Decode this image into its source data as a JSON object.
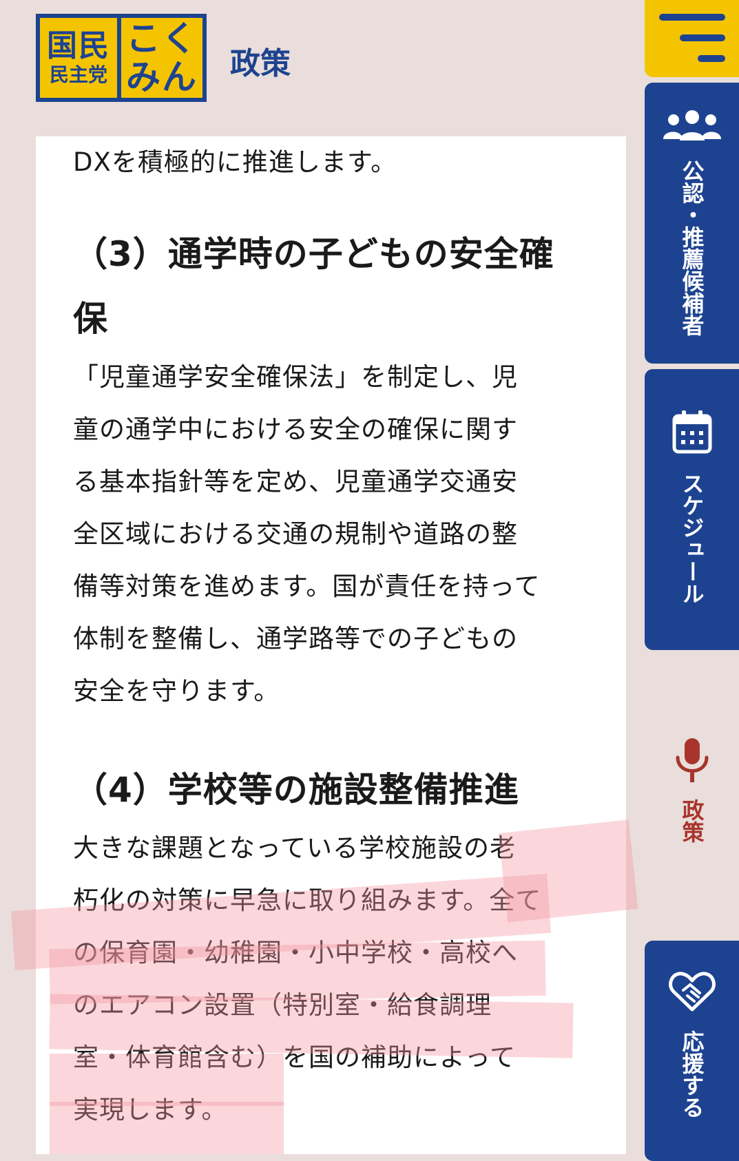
{
  "logo": {
    "line1": "国民",
    "line2": "民主党",
    "right1": "こく",
    "right2": "みん"
  },
  "page_label": "政策",
  "content": {
    "intro_tail": "DXを積極的に推進します。",
    "section3_heading_line1": "（3）通学時の子どもの安全確",
    "section3_heading_line2": "保",
    "section3_lines": [
      "「児童通学安全確保法」を制定し、児",
      "童の通学中における安全の確保に関す",
      "る基本指針等を定め、児童通学交通安",
      "全区域における交通の規制や道路の整",
      "備等対策を進めます。国が責任を持って",
      "体制を整備し、通学路等での子どもの",
      "安全を守ります。"
    ],
    "section4_heading": "（4）学校等の施設整備推進",
    "section4_lines": [
      "大きな課題となっている学校施設の老",
      "朽化の対策に早急に取り組みます。全て",
      "の保育園・幼稚園・小中学校・高校へ",
      "のエアコン設置（特別室・給食調理",
      "室・体育館含む）を国の補助によって",
      "実現します。"
    ]
  },
  "side_nav": {
    "candidates_label": "公認・推薦候補者",
    "schedule_label": "スケジュール",
    "policy_label": "政策",
    "support_label": "応援する"
  },
  "colors": {
    "brand_blue": "#1d4390",
    "brand_yellow": "#f5c400",
    "policy_red": "#a8342c",
    "background": "#e9dedb",
    "highlight_pink": "#f496a0"
  }
}
